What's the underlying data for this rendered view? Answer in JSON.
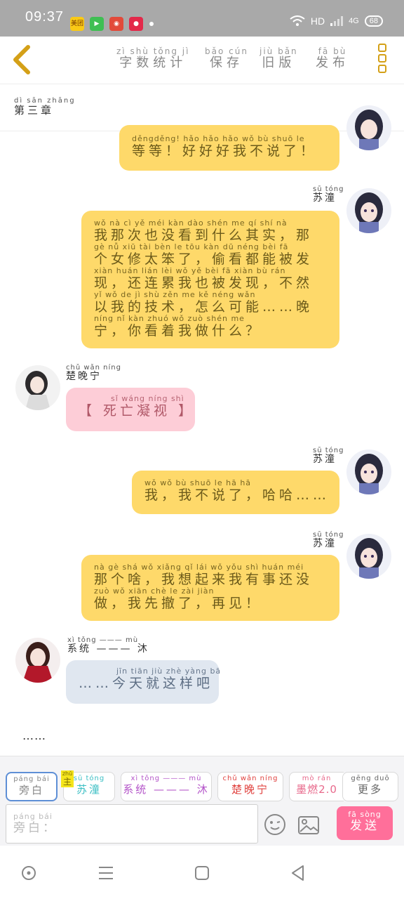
{
  "status_bar": {
    "time": "09:37",
    "network": "HD",
    "signal": "4G",
    "battery": "68",
    "app_icons": [
      {
        "name": "meituan-app-icon",
        "label": "美团",
        "color": "#f9c916"
      },
      {
        "name": "video-app-icon",
        "label": "",
        "color": "#3fbf53"
      },
      {
        "name": "weibo-app-icon",
        "label": "",
        "color": "#e24a3a"
      },
      {
        "name": "red-app-icon",
        "label": "",
        "color": "#e3294a"
      }
    ]
  },
  "header": {
    "buttons": [
      {
        "py": "zì shù tǒng jì",
        "hz": "字数统计"
      },
      {
        "py": "bǎo cún",
        "hz": "保存"
      },
      {
        "py": "jiù bǎn",
        "hz": "旧版"
      },
      {
        "py": "fā bù",
        "hz": "发布"
      }
    ]
  },
  "chapter": {
    "py": "dì sān zhāng",
    "hz": "第三章"
  },
  "messages": [
    {
      "speaker": "",
      "lines": [
        {
          "py": "děngděng!  hǎo hǎo hǎo wǒ bù shuō le",
          "hz": "等等！好好好我不说了！"
        }
      ]
    },
    {
      "speaker": {
        "py": "sū tóng",
        "hz": "苏潼"
      },
      "lines": [
        {
          "py": "wǒ nà cì yě méi kàn dào shén me qí shí   nà",
          "hz": "我那次也没看到什么其实，那"
        },
        {
          "py": "gè nǚ xiū tài bèn le   tōu kàn dū néng bèi fā",
          "hz": "个女修太笨了，偷看都能被发"
        },
        {
          "py": "xiàn   huán lián lèi wǒ yě bèi fā xiàn   bù rán",
          "hz": "现，还连累我也被发现，不然"
        },
        {
          "py": "yǐ wǒ de jì shù   zěn me kě néng   wǎn",
          "hz": "以我的技术，怎么可能……晚"
        },
        {
          "py": "níng   nǐ kàn zhuó wǒ zuò shén me",
          "hz": "宁，你看着我做什么？"
        }
      ]
    },
    {
      "speaker": {
        "py": "chǔ wǎn níng",
        "hz": "楚晚宁"
      },
      "lines": [
        {
          "py": "sǐ wáng níng shì",
          "hz": "【 死亡凝视 】"
        }
      ]
    },
    {
      "speaker": {
        "py": "sū tóng",
        "hz": "苏潼"
      },
      "lines": [
        {
          "py": "wǒ   wǒ bù shuō le   hā hā",
          "hz": "我，我不说了，哈哈……"
        }
      ]
    },
    {
      "speaker": {
        "py": "sū tóng",
        "hz": "苏潼"
      },
      "lines": [
        {
          "py": "nà gè shá   wǒ xiǎng qǐ lái wǒ yǒu shì huán méi",
          "hz": "那个啥，我想起来我有事还没"
        },
        {
          "py": "zuò   wǒ xiān chè le   zài jiàn",
          "hz": "做，我先撤了，再见！"
        }
      ]
    },
    {
      "speaker": {
        "py": "xì tǒng ——— mù",
        "hz": "系统 ——— 沐"
      },
      "lines": [
        {
          "py": "jīn tiān jiù zhè yàng bā",
          "hz": "……今天就这样吧"
        }
      ]
    }
  ],
  "trailing_text": "……",
  "roles": [
    {
      "py": "páng bái",
      "hz": "旁白",
      "color": "#888888"
    },
    {
      "py": "sū tóng",
      "hz": "苏潼",
      "color": "#3bbfc4"
    },
    {
      "py": "xì tǒng ——— mù",
      "hz": "系统 ——— 沐",
      "color": "#b455c9"
    },
    {
      "py": "chǔ wǎn níng",
      "hz": "楚晚宁",
      "color": "#e0413e"
    },
    {
      "py": "mò rán",
      "hz": "墨燃2.0",
      "color": "#e86a8c"
    },
    {
      "py": "gēng duō",
      "hz": "更多",
      "color": "#666666"
    }
  ],
  "zhu_badge": {
    "py": "zhǔ",
    "hz": "主"
  },
  "input": {
    "py": "páng bái",
    "hz": "旁白："
  },
  "send_button": {
    "py": "fā sòng",
    "hz": "发送"
  },
  "colors": {
    "yellow_bubble": "#fed96a",
    "pink_bubble": "#fdcdd7",
    "blue_bubble": "#e0e7f0",
    "send": "#ff6f9a",
    "icon_gold": "#d4a017"
  }
}
